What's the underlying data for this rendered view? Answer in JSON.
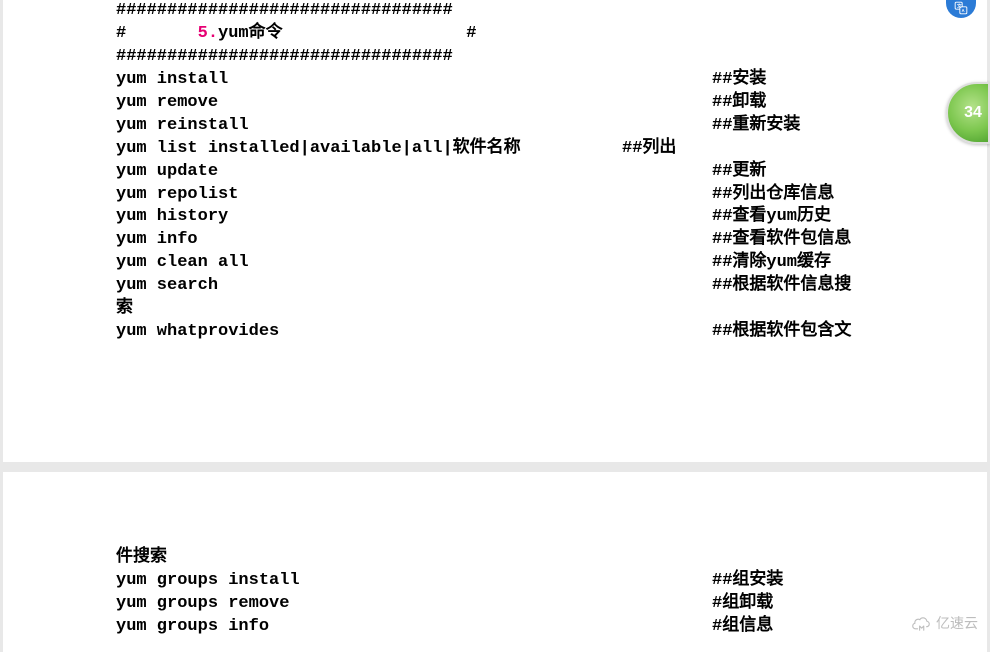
{
  "header": {
    "hr": "#################################",
    "title_left": "#       ",
    "title_num": "5.",
    "title_text": "yum命令",
    "title_right": "                  #"
  },
  "commands": [
    {
      "cmd": "yum install",
      "cmt": "##安装",
      "wide": true
    },
    {
      "cmd": "yum remove",
      "cmt": "##卸载",
      "wide": true
    },
    {
      "cmd": "yum reinstall",
      "cmt": "##重新安装",
      "wide": true
    },
    {
      "cmd": "yum list installed|available|all|软件名称       ",
      "cmt": "##列出",
      "wide": false
    },
    {
      "cmd": "yum update",
      "cmt": "##更新",
      "wide": true
    },
    {
      "cmd": "yum repolist",
      "cmt": "##列出仓库信息",
      "wide": true
    },
    {
      "cmd": "yum history",
      "cmt": "##查看yum历史",
      "wide": true
    },
    {
      "cmd": "yum info",
      "cmt": "##查看软件包信息",
      "wide": true
    },
    {
      "cmd": "yum clean all",
      "cmt": "##清除yum缓存",
      "wide": true
    },
    {
      "cmd": "yum search",
      "cmt": "##根据软件信息搜",
      "wide": true
    }
  ],
  "wrap1": "索",
  "cmd_whatprovides": {
    "cmd": "yum whatprovides",
    "cmt": "##根据软件包含文"
  },
  "wrap2": "件搜索",
  "groups": [
    {
      "cmd": "yum groups install",
      "cmt": "##组安装"
    },
    {
      "cmd": "yum groups remove",
      "cmt": "#组卸载"
    },
    {
      "cmd": "yum groups info",
      "cmt": "#组信息"
    }
  ],
  "badge": "34",
  "watermark": "亿速云"
}
